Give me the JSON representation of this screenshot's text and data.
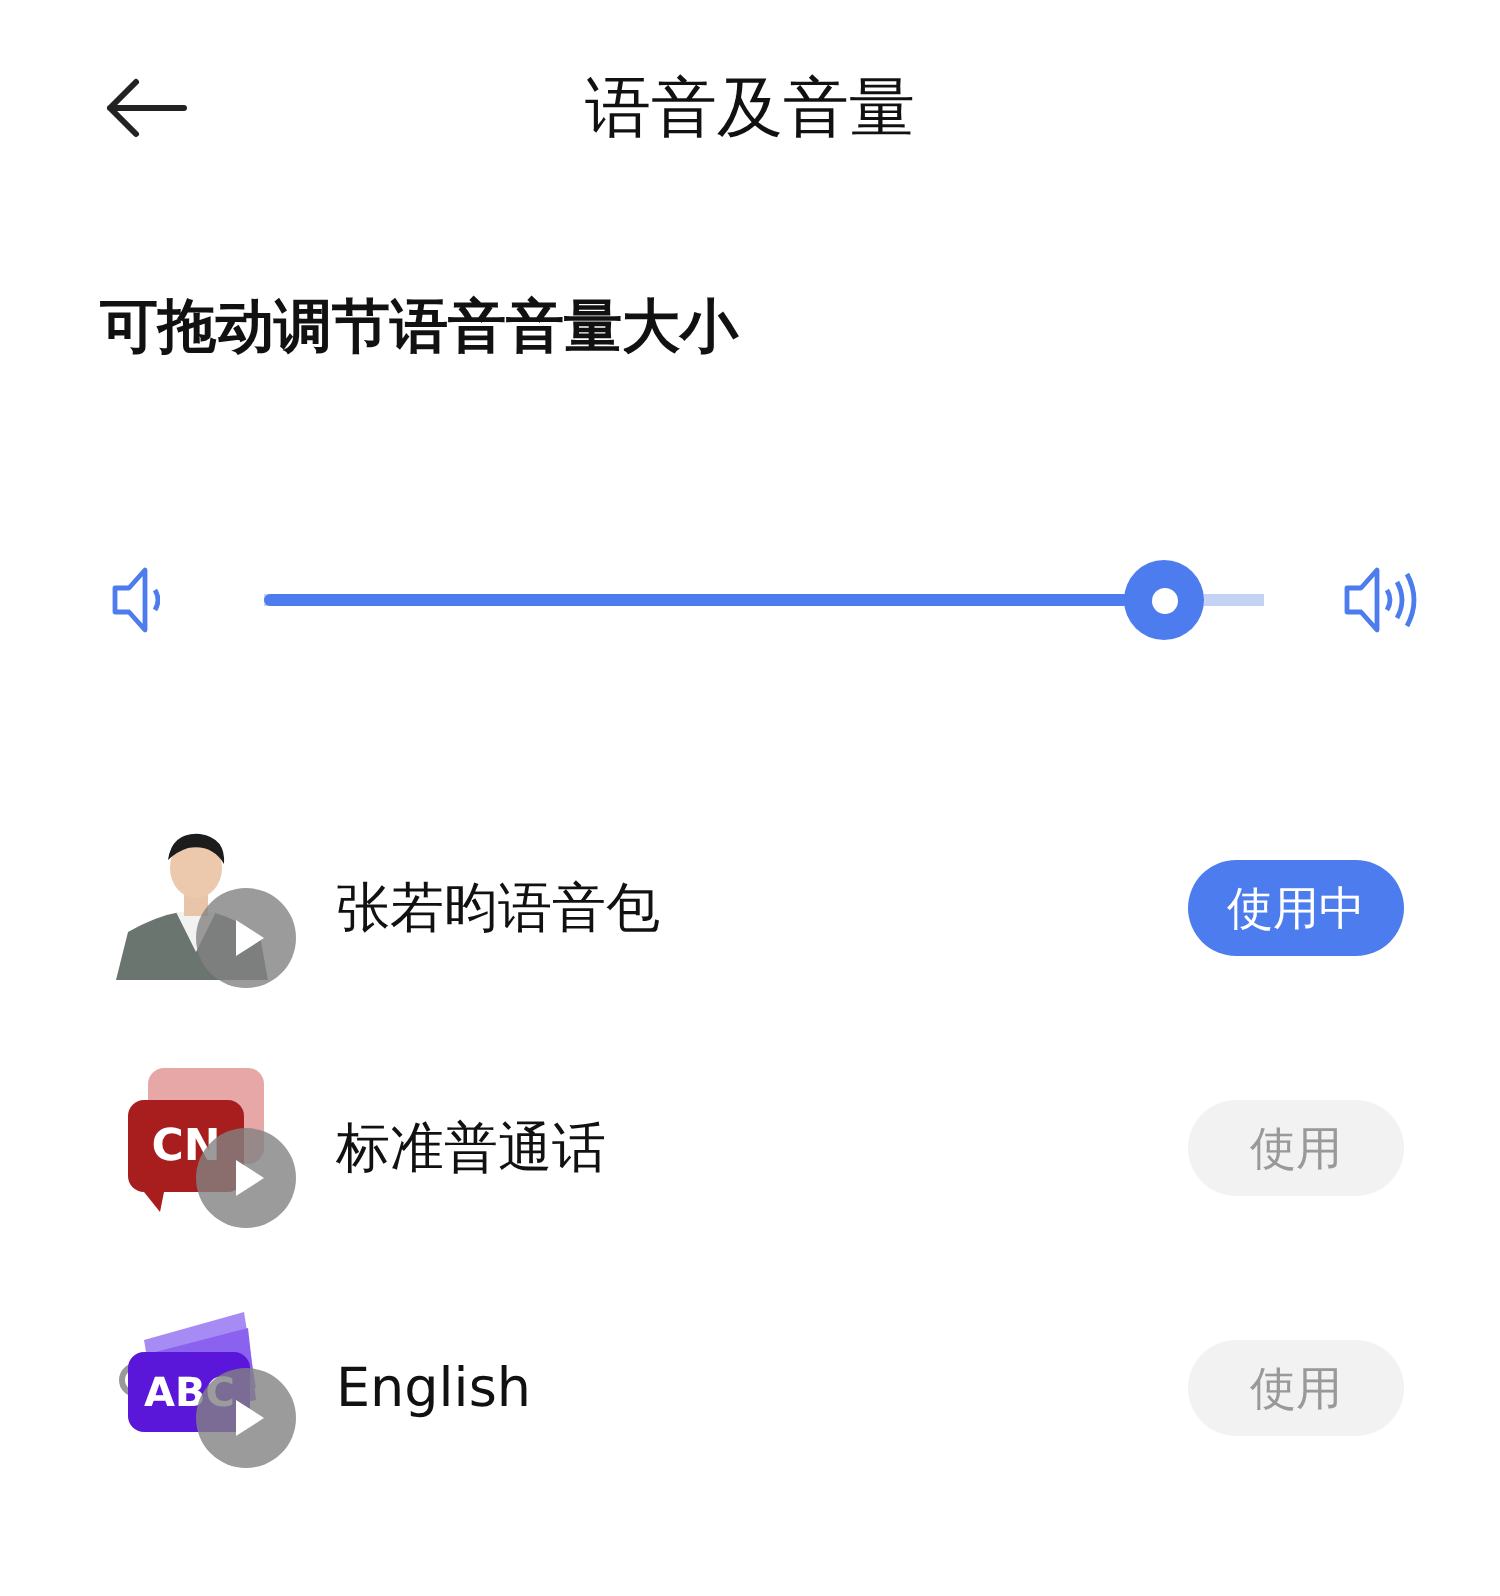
{
  "header": {
    "title": "语音及音量"
  },
  "volume": {
    "label": "可拖动调节语音音量大小",
    "level": 0.9
  },
  "voice_packs": [
    {
      "kind": "picture",
      "name": "张若昀语音包",
      "button": "使用中",
      "selected": true
    },
    {
      "kind": "cn",
      "badge": "CN",
      "name": "标准普通话",
      "button": "使用",
      "selected": false
    },
    {
      "kind": "abc",
      "badge": "ABC",
      "name": "English",
      "button": "使用",
      "selected": false
    }
  ]
}
